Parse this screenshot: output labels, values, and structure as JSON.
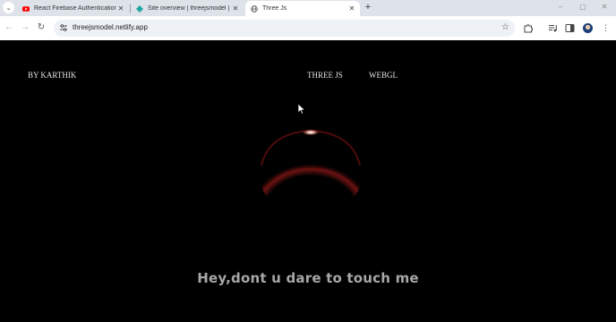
{
  "browser": {
    "tabs": [
      {
        "title": "React Firebase Authentication",
        "favicon": "youtube-icon",
        "active": false
      },
      {
        "title": "Site overview | threejsmodel | N",
        "favicon": "netlify-icon",
        "active": false
      },
      {
        "title": "Three Js",
        "favicon": "globe-icon",
        "active": true
      }
    ],
    "url": "threejsmodel.netlify.app"
  },
  "page": {
    "brand": "BY KARTHIK",
    "nav": [
      "THREE JS",
      "WEBGL"
    ],
    "headline": "Hey,dont u dare to touch me"
  },
  "colors": {
    "page_background": "#000000",
    "sphere_rim": "#8b1a1a",
    "highlight": "#ffffff",
    "headline": "#a7a7a7"
  }
}
